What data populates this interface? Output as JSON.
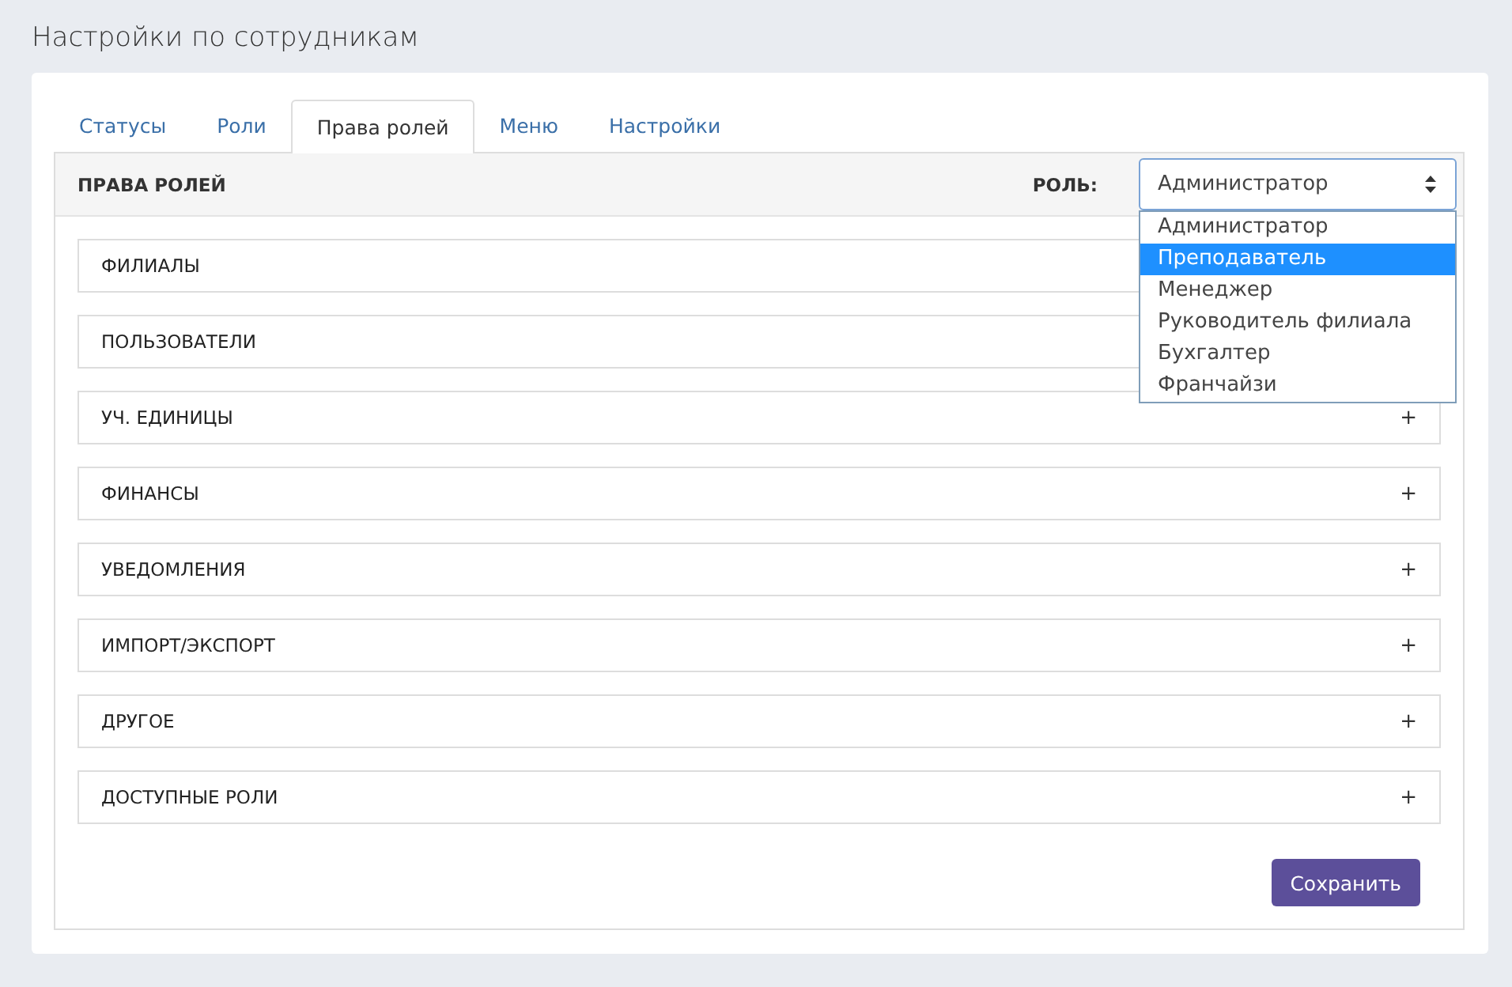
{
  "page_title": "Настройки по сотрудникам",
  "tabs": [
    {
      "label": "Статусы",
      "selected": false
    },
    {
      "label": "Роли",
      "selected": false
    },
    {
      "label": "Права ролей",
      "selected": true
    },
    {
      "label": "Меню",
      "selected": false
    },
    {
      "label": "Настройки",
      "selected": false
    }
  ],
  "panel": {
    "title": "ПРАВА РОЛЕЙ",
    "role_label": "РОЛЬ:",
    "role_select": {
      "value": "Администратор",
      "expanded": true,
      "options": [
        {
          "label": "Администратор",
          "highlighted": false
        },
        {
          "label": "Преподаватель",
          "highlighted": true
        },
        {
          "label": "Менеджер",
          "highlighted": false
        },
        {
          "label": "Руководитель филиала",
          "highlighted": false
        },
        {
          "label": "Бухгалтер",
          "highlighted": false
        },
        {
          "label": "Франчайзи",
          "highlighted": false
        }
      ]
    }
  },
  "sections": [
    {
      "title": "ФИЛИАЛЫ"
    },
    {
      "title": "ПОЛЬЗОВАТЕЛИ"
    },
    {
      "title": "УЧ. ЕДИНИЦЫ",
      "toggle": "+"
    },
    {
      "title": "ФИНАНСЫ",
      "toggle": "+"
    },
    {
      "title": "УВЕДОМЛЕНИЯ",
      "toggle": "+"
    },
    {
      "title": "ИМПОРТ/ЭКСПОРТ",
      "toggle": "+"
    },
    {
      "title": "ДРУГОЕ",
      "toggle": "+"
    },
    {
      "title": "ДОСТУПНЫЕ РОЛИ",
      "toggle": "+"
    }
  ],
  "save_button": "Сохранить"
}
